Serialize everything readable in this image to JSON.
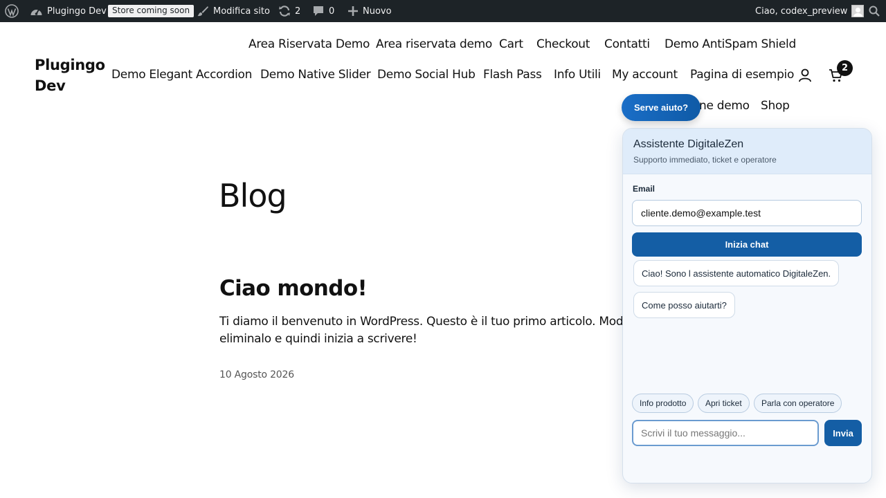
{
  "adminbar": {
    "wp_logo_icon": "wordpress-icon",
    "site_name": "Plugingo Dev",
    "store_badge": "Store coming soon",
    "edit_site": "Modifica sito",
    "updates_count": "2",
    "comments_count": "0",
    "new_label": "Nuovo",
    "greeting": "Ciao, codex_preview"
  },
  "site": {
    "title": "Plugingo Dev",
    "nav": [
      "Area Riservata Demo",
      "Area riservata demo",
      "Cart",
      "Checkout",
      "Contatti",
      "Demo AntiSpam Shield",
      "Demo Elegant Accordion",
      "Demo Native Slider",
      "Demo Social Hub",
      "Flash Pass",
      "Info Utili",
      "My account",
      "Pagina di esempio",
      "ne demo",
      "Shop"
    ],
    "cart_count": "2"
  },
  "content": {
    "page_title": "Blog",
    "post_title": "Ciao mondo!",
    "post_excerpt": "Ti diamo il benvenuto in WordPress. Questo è il tuo primo articolo. Modifica",
    "post_excerpt_line2": "eliminalo e quindi inizia a scrivere!",
    "post_date": "10 Agosto 2026"
  },
  "chat": {
    "help_button": "Serve aiuto?",
    "title": "Assistente DigitaleZen",
    "subtitle": "Supporto immediato, ticket e operatore",
    "email_label": "Email",
    "email_value": "cliente.demo@example.test",
    "start_button": "Inizia chat",
    "messages": [
      "Ciao! Sono l assistente automatico DigitaleZen.",
      "Come posso aiutarti?"
    ],
    "quick_replies": [
      "Info prodotto",
      "Apri ticket",
      "Parla con operatore"
    ],
    "input_placeholder": "Scrivi il tuo messaggio...",
    "send_button": "Invia",
    "colors": {
      "primary": "#145ea5",
      "header_bg": "#dfecfa",
      "panel_bg": "#f6f9fd"
    }
  }
}
